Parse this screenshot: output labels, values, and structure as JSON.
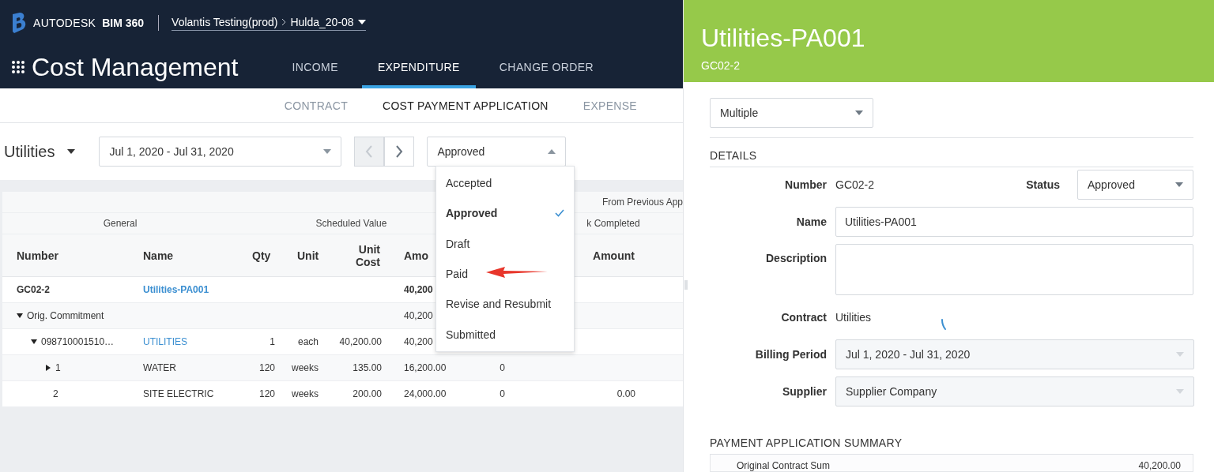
{
  "header": {
    "brand": "AUTODESK",
    "product": "BIM 360",
    "breadcrumb": [
      {
        "label": "Volantis Testing(prod)"
      },
      {
        "label": "Hulda_20-08"
      }
    ],
    "app_title": "Cost Management"
  },
  "tabs": [
    {
      "label": "INCOME",
      "selected": false
    },
    {
      "label": "EXPENDITURE",
      "selected": true
    },
    {
      "label": "CHANGE ORDER",
      "selected": false
    }
  ],
  "subtabs": [
    {
      "label": "CONTRACT",
      "selected": false
    },
    {
      "label": "COST PAYMENT APPLICATION",
      "selected": true
    },
    {
      "label": "EXPENSE",
      "selected": false
    }
  ],
  "filters": {
    "contract": "Utilities",
    "period": "Jul 1, 2020 - Jul 31, 2020",
    "prev": {
      "disabled": true
    },
    "next": {
      "disabled": false
    },
    "status": {
      "value": "Approved",
      "expanded": true,
      "options": [
        {
          "label": "Accepted",
          "selected": false
        },
        {
          "label": "Approved",
          "selected": true
        },
        {
          "label": "Draft",
          "selected": false
        },
        {
          "label": "Paid",
          "selected": false
        },
        {
          "label": "Revise and Resubmit",
          "selected": false
        },
        {
          "label": "Submitted",
          "selected": false
        }
      ]
    }
  },
  "table": {
    "top_group": "From Previous App",
    "groups": [
      "General",
      "Scheduled Value",
      "k Completed"
    ],
    "columns": [
      "Number",
      "Name",
      "Qty",
      "Unit",
      "Unit Cost",
      "Amo",
      "Amount"
    ],
    "rows": [
      {
        "kind": "total",
        "number": "GC02-2",
        "name": "Utilities-PA001",
        "amount": "40,200"
      },
      {
        "kind": "group",
        "label": "Orig. Commitment",
        "expanded": true,
        "amount": "40,200",
        "children": [
          {
            "kind": "item",
            "number": "098710001510…",
            "name": "UTILITIES",
            "qty": "1",
            "unit": "each",
            "unit_cost": "40,200.00",
            "amount": "40,200",
            "expanded": true,
            "children": [
              {
                "kind": "item",
                "number": "1",
                "name": "WATER",
                "qty": "120",
                "unit": "weeks",
                "unit_cost": "135.00",
                "amount": "16,200.00",
                "column_7": "0",
                "expanded": false
              },
              {
                "kind": "item",
                "number": "2",
                "name": "SITE ELECTRIC",
                "qty": "120",
                "unit": "weeks",
                "unit_cost": "200.00",
                "amount": "24,000.00",
                "column_7": "0",
                "column_8": "0.00"
              }
            ]
          }
        ]
      }
    ]
  },
  "panel": {
    "title": "Utilities-PA001",
    "subtitle": "GC02-2",
    "view": "Multiple",
    "details_title": "DETAILS",
    "number": {
      "label": "Number",
      "value": "GC02-2"
    },
    "status": {
      "label": "Status",
      "value": "Approved"
    },
    "fields": [
      {
        "kind": "input",
        "label": "Name",
        "value": "Utilities-PA001"
      },
      {
        "kind": "textarea",
        "label": "Description"
      },
      {
        "kind": "text",
        "label": "Contract",
        "value": "Utilities"
      },
      {
        "kind": "select",
        "label": "Billing Period",
        "value": "Jul 1, 2020 - Jul 31, 2020",
        "disabled": true
      },
      {
        "kind": "select",
        "label": "Supplier",
        "value": "Supplier Company",
        "disabled": true
      }
    ],
    "loading": true,
    "summary_title": "PAYMENT APPLICATION SUMMARY",
    "summary": [
      {
        "label": "Original Contract Sum",
        "value": "40,200.00"
      }
    ]
  }
}
